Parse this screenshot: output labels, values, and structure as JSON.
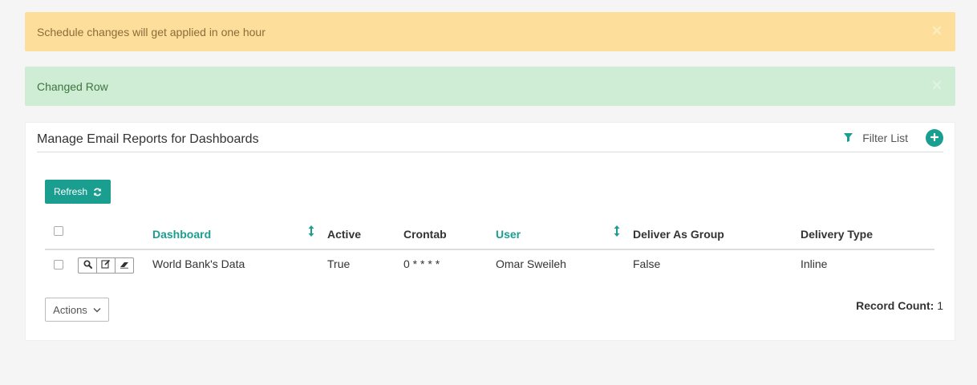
{
  "alerts": {
    "warning": "Schedule changes will get applied in one hour",
    "success": "Changed Row"
  },
  "panel": {
    "title": "Manage Email Reports for Dashboards",
    "filter_label": "Filter List",
    "refresh_label": "Refresh"
  },
  "table": {
    "headers": {
      "dashboard": "Dashboard",
      "active": "Active",
      "crontab": "Crontab",
      "user": "User",
      "deliver_as_group": "Deliver As Group",
      "delivery_type": "Delivery Type"
    },
    "rows": [
      {
        "dashboard": "World Bank's Data",
        "active": "True",
        "crontab": "0 * * * *",
        "user": "Omar Sweileh",
        "deliver_as_group": "False",
        "delivery_type": "Inline"
      }
    ]
  },
  "footer": {
    "actions_label": "Actions",
    "record_count_label": "Record Count:",
    "record_count_value": "1"
  },
  "colors": {
    "accent": "#1a9e8f",
    "warning_bg": "#fddf9b",
    "success_bg": "#cfecd5"
  },
  "icons": [
    "close-icon",
    "filter-icon",
    "plus-icon",
    "refresh-icon",
    "sort-icon",
    "search-icon",
    "edit-icon",
    "eraser-icon",
    "chevron-down-icon"
  ]
}
